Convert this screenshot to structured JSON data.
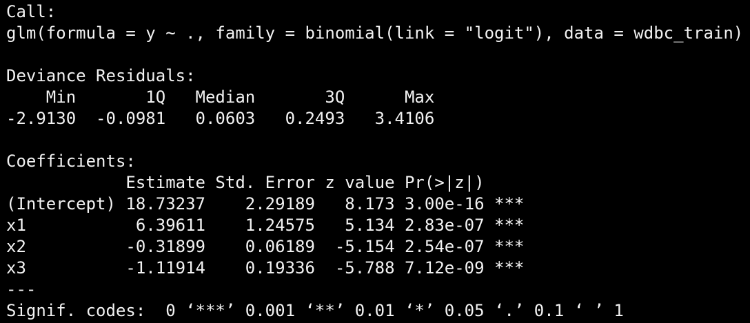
{
  "console": {
    "call_header": "Call:",
    "call_formula": "glm(formula = y ~ ., family = binomial(link = \"logit\"), data = wdbc_train)",
    "deviance_header": "Deviance Residuals:",
    "deviance_columns": "    Min       1Q   Median       3Q      Max  ",
    "deviance_values": "-2.9130  -0.0981   0.0603   0.2493   3.4106  ",
    "coefficients_header": "Coefficients:",
    "coef_columns": "            Estimate Std. Error z value Pr(>|z|)    ",
    "coef_rows": [
      "(Intercept) 18.73237    2.29189   8.173 3.00e-16 ***",
      "x1           6.39611    1.24575   5.134 2.83e-07 ***",
      "x2          -0.31899    0.06189  -5.154 2.54e-07 ***",
      "x3          -1.11914    0.19336  -5.788 7.12e-09 ***"
    ],
    "separator": "---",
    "signif_codes": "Signif. codes:  0 ‘***’ 0.001 ‘**’ 0.01 ‘*’ 0.05 ‘.’ 0.1 ‘ ’ 1"
  },
  "colors": {
    "background": "#000000",
    "text": "#f2f2f2"
  }
}
